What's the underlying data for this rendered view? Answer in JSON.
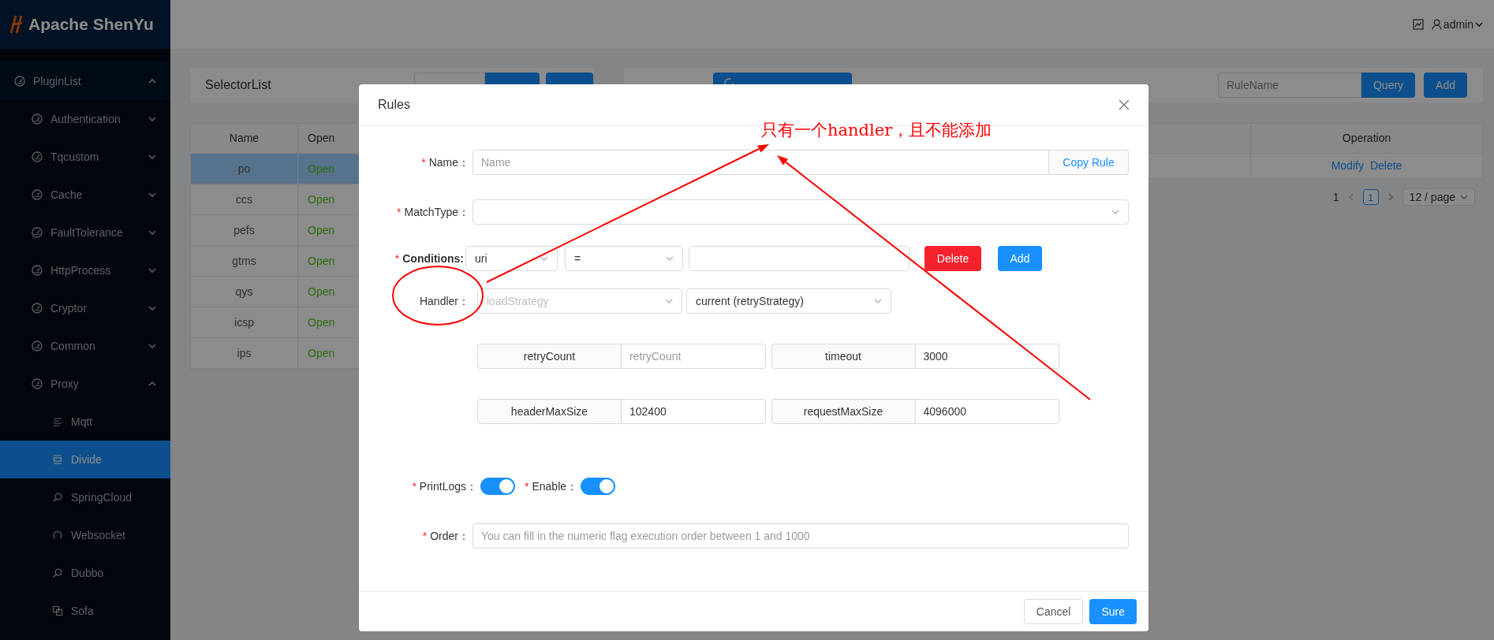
{
  "sidebar": {
    "logo": "Apache ShenYu",
    "menu": [
      {
        "label": "PluginList",
        "expanded": true,
        "children": [
          {
            "label": "Authentication",
            "expanded": false
          },
          {
            "label": "Tqcustom",
            "expanded": false
          },
          {
            "label": "Cache",
            "expanded": false
          },
          {
            "label": "FaultTolerance",
            "expanded": false
          },
          {
            "label": "HttpProcess",
            "expanded": false
          },
          {
            "label": "Cryptor",
            "expanded": false
          },
          {
            "label": "Common",
            "expanded": false
          },
          {
            "label": "Proxy",
            "expanded": true,
            "children": [
              {
                "label": "Mqtt",
                "kind": "lines",
                "selected": false
              },
              {
                "label": "Divide",
                "kind": "split",
                "selected": true
              },
              {
                "label": "SpringCloud",
                "kind": "search",
                "selected": false
              },
              {
                "label": "Websocket",
                "kind": "loop",
                "selected": false
              },
              {
                "label": "Dubbo",
                "kind": "search",
                "selected": false
              },
              {
                "label": "Sofa",
                "kind": "squares",
                "selected": false
              }
            ]
          }
        ]
      }
    ]
  },
  "header": {
    "user": "admin"
  },
  "selector_panel": {
    "title": "SelectorList",
    "table": {
      "columns": [
        "Name",
        "Open"
      ],
      "rows": [
        {
          "name": "po",
          "status": "Open",
          "selected": true
        },
        {
          "name": "ccs",
          "status": "Open",
          "selected": false
        },
        {
          "name": "pefs",
          "status": "Open",
          "selected": false
        },
        {
          "name": "gtms",
          "status": "Open",
          "selected": false
        },
        {
          "name": "qys",
          "status": "Open",
          "selected": false
        },
        {
          "name": "icsp",
          "status": "Open",
          "selected": false
        },
        {
          "name": "ips",
          "status": "Open",
          "selected": false
        }
      ]
    }
  },
  "rules_panel": {
    "search": {
      "placeholder": "RuleName"
    },
    "buttons": [
      "Query",
      "Add"
    ],
    "table": {
      "columns": [
        "Operation"
      ],
      "rows": [
        {
          "actions": [
            "Modify",
            "Delete"
          ]
        }
      ]
    },
    "pagination": {
      "total": "1",
      "pages": [
        {
          "label": "1",
          "selected": true
        }
      ],
      "page_size": "12 / page"
    }
  },
  "modal": {
    "title": "Rules",
    "name": {
      "mark": "*",
      "label": "Name：",
      "placeholder": "Name",
      "button": "Copy Rule"
    },
    "match_type": {
      "mark": "*",
      "label": "MatchType："
    },
    "conditions": {
      "mark": "*",
      "label": "Conditions:",
      "param": "uri",
      "operator": "=",
      "buttons": [
        "Delete",
        "Add"
      ]
    },
    "handler": {
      "label": "Handler：",
      "load_strategy": {
        "placeholder": "loadStrategy"
      },
      "retry_strategy": {
        "value": "current (retryStrategy)"
      },
      "params": [
        {
          "label": "retryCount",
          "placeholder": "retryCount"
        },
        {
          "label": "timeout",
          "value": "3000"
        },
        {
          "label": "headerMaxSize",
          "value": "102400"
        },
        {
          "label": "requestMaxSize",
          "value": "4096000"
        }
      ]
    },
    "switches": [
      {
        "mark": "*",
        "label": "PrintLogs：",
        "on": true
      },
      {
        "mark": "*",
        "label": "Enable：",
        "on": true
      }
    ],
    "order": {
      "mark": "*",
      "label": "Order：",
      "placeholder": "You can fill in the numeric flag execution order between 1 and 1000"
    },
    "footer_buttons": [
      "Cancel",
      "Sure"
    ]
  },
  "annotation": {
    "note": "只有一个handler，且不能添加"
  }
}
